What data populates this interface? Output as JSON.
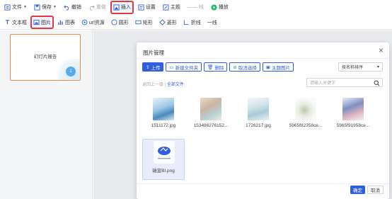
{
  "toolbar1": {
    "file_label": "文件",
    "save_label": "保存",
    "undo_label": "撤销",
    "redo_label": "重做",
    "insert_label": "插入",
    "settings_label": "设置",
    "theme_label": "主题",
    "line_label": "线",
    "play_label": "播放"
  },
  "toolbar2": {
    "textbox_label": "文本框",
    "image_label": "图片",
    "chart_label": "图表",
    "url_label": "url资源",
    "circle_label": "圆形",
    "rect_label": "矩形",
    "diamond_label": "菱形",
    "polyline_label": "折线",
    "line_label": "一线"
  },
  "slide": {
    "title": "幻灯片报告",
    "number": "1"
  },
  "modal": {
    "title": "图片管理",
    "buttons": {
      "upload": "上传",
      "new_folder": "新建文件夹",
      "delete": "删除",
      "cancel_select": "取消选择",
      "theme_image": "主题图片"
    },
    "sort_value": "按名称排序",
    "breadcrumb_back": "返回上一级",
    "breadcrumb_sep": "|",
    "breadcrumb_all": "全部文件",
    "search_placeholder": "请输入关键字",
    "files": [
      {
        "name": "1511172.jpg"
      },
      {
        "name": "153486276152..."
      },
      {
        "name": "1726217.jpg"
      },
      {
        "name": "5965f82358ce..."
      },
      {
        "name": "5965f91958ce..."
      },
      {
        "name": "瑞宣BI.png"
      }
    ],
    "ok_label": "确定",
    "cancel_label": "取消"
  },
  "colors": {
    "accent": "#2f5fe0",
    "highlight_border": "#e23b3b",
    "slide_border": "#f08a4b"
  }
}
